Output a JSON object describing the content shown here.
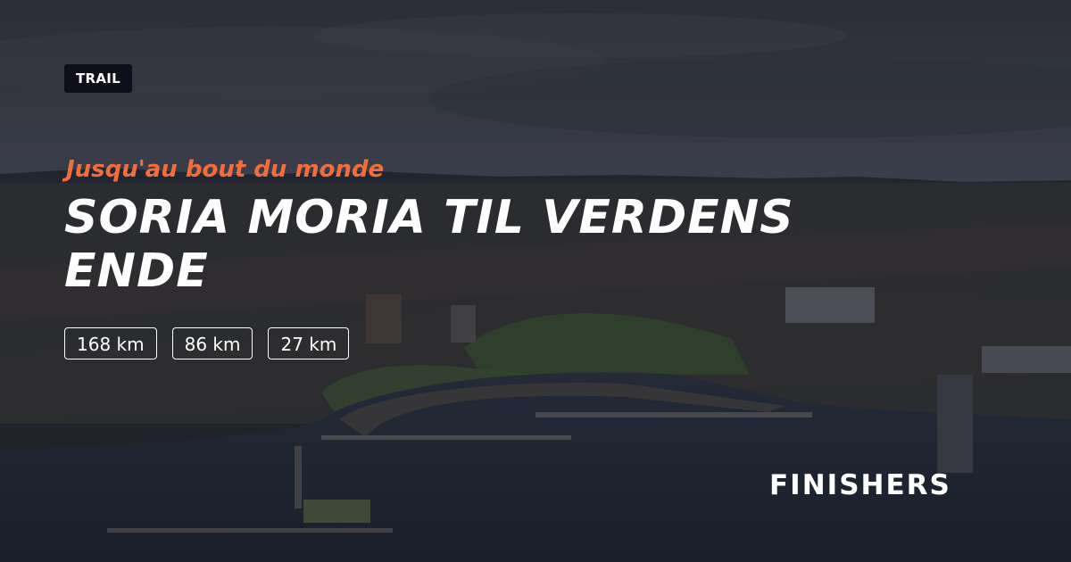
{
  "category": {
    "label": "TRAIL"
  },
  "event": {
    "tagline": "Jusqu'au bout du monde",
    "title": "SORIA MORIA TIL VERDENS ENDE"
  },
  "distances": [
    "168 km",
    "86 km",
    "27 km"
  ],
  "brand": {
    "logo_text": "FINISHERS"
  },
  "colors": {
    "accent": "#f26d3a",
    "badge_bg": "#0e0f1a",
    "text": "#ffffff"
  }
}
